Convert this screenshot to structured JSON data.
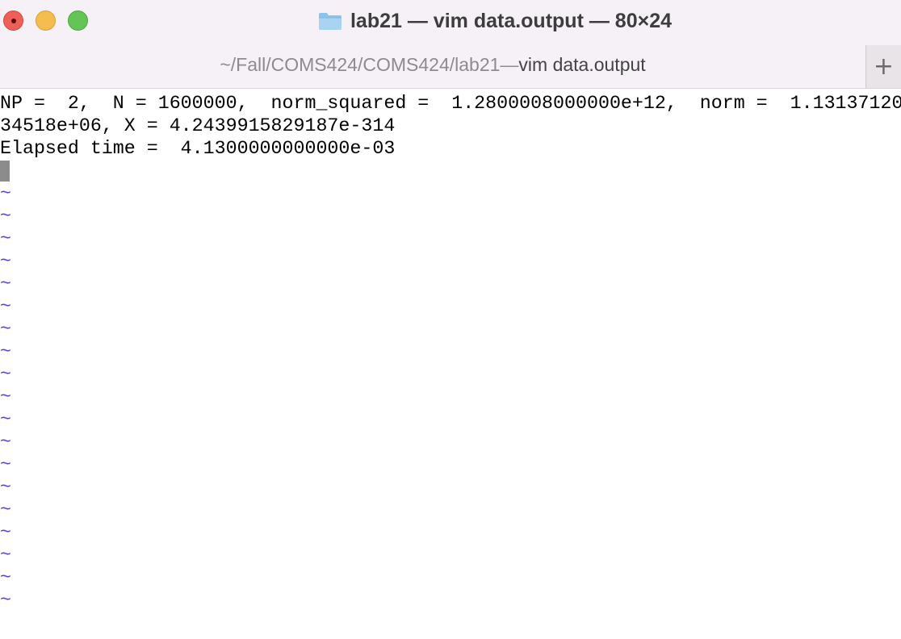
{
  "window": {
    "title": "lab21 — vim data.output — 80×24",
    "colors": {
      "titlebar_bg": "#f6f1f6",
      "close": "#ee5f57",
      "minimize": "#f5bd4f",
      "zoom": "#62c554",
      "tilde": "#5a3ff0",
      "cursor": "#8c8c8c"
    }
  },
  "tab": {
    "path": "~/Fall/COMS424/COMS424/lab21",
    "separator": " — ",
    "command": "vim data.output",
    "new_tab_label": "+"
  },
  "icons": {
    "title_icon": "folder-icon",
    "new_tab": "plus-icon"
  },
  "buffer": {
    "lines": [
      "NP =  2,  N = 1600000,  norm_squared =  1.2800008000000e+12,  norm =  1.13137120",
      "34518e+06, X = 4.2439915829187e-314",
      "Elapsed time =  4.1300000000000e-03"
    ],
    "empty_line_marker": "~",
    "empty_lines": [
      "~",
      "~",
      "~",
      "~",
      "~",
      "~",
      "~",
      "~",
      "~",
      "~",
      "~",
      "~",
      "~",
      "~",
      "~",
      "~",
      "~",
      "~",
      "~"
    ]
  }
}
